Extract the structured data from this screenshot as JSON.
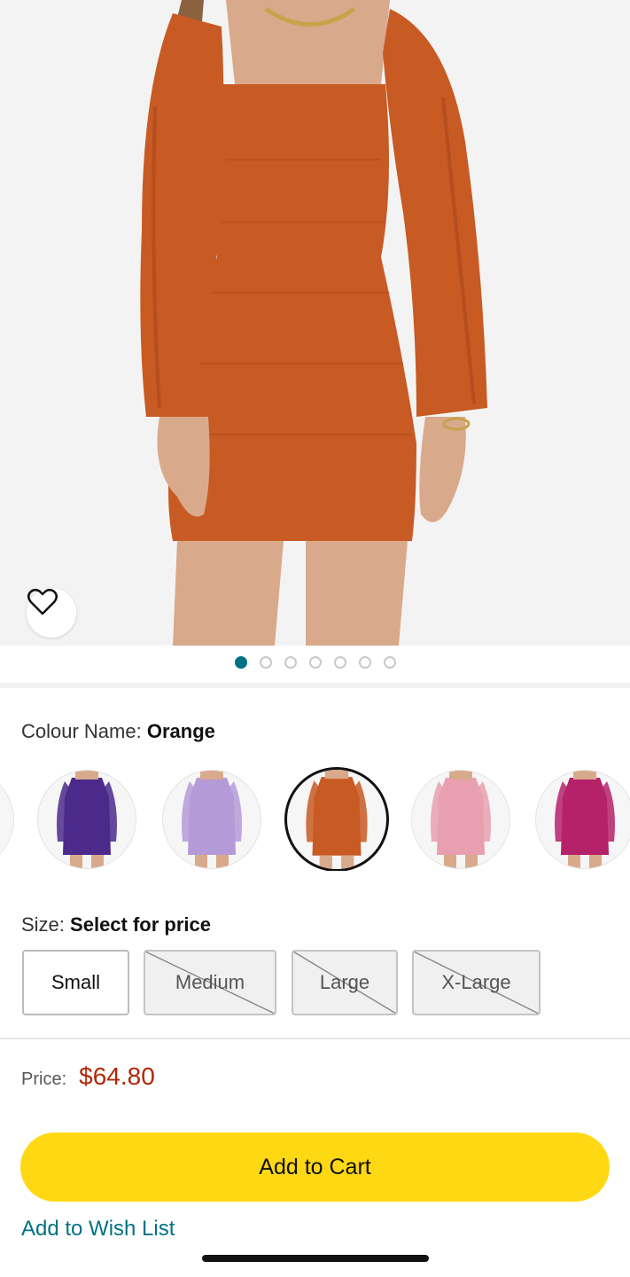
{
  "product": {
    "main_image_alt": "Orange long sleeve bodycon mini dress",
    "image_count": 7,
    "active_image_index": 0,
    "colors": {
      "dress": "#c85a23",
      "dress_shadow": "#a8461a",
      "skin": "#d9a98c",
      "hair": "#8a6240",
      "background": "#f3f3f3"
    }
  },
  "wishlist_icon": "heart-outline-icon",
  "colour": {
    "label": "Colour Name:",
    "selected": "Orange",
    "swatches": [
      {
        "name": "Partial",
        "color": "#8a8a8a"
      },
      {
        "name": "Purple",
        "color": "#4b2a8c"
      },
      {
        "name": "Lavender",
        "color": "#b59ad8"
      },
      {
        "name": "Orange",
        "color": "#c85a23",
        "selected": true
      },
      {
        "name": "Pink",
        "color": "#e8a0b0"
      },
      {
        "name": "Magenta",
        "color": "#b5226a"
      }
    ]
  },
  "size": {
    "label": "Size:",
    "selected_text": "Select for price",
    "options": [
      {
        "label": "Small",
        "available": true
      },
      {
        "label": "Medium",
        "available": false
      },
      {
        "label": "Large",
        "available": false
      },
      {
        "label": "X-Large",
        "available": false
      }
    ]
  },
  "price": {
    "label": "Price:",
    "value": "$64.80"
  },
  "actions": {
    "add_to_cart": "Add to Cart",
    "add_to_wish_list": "Add to Wish List"
  },
  "accent": {
    "cart_button": "#ffd814",
    "link": "#007185",
    "price": "#b12704"
  }
}
